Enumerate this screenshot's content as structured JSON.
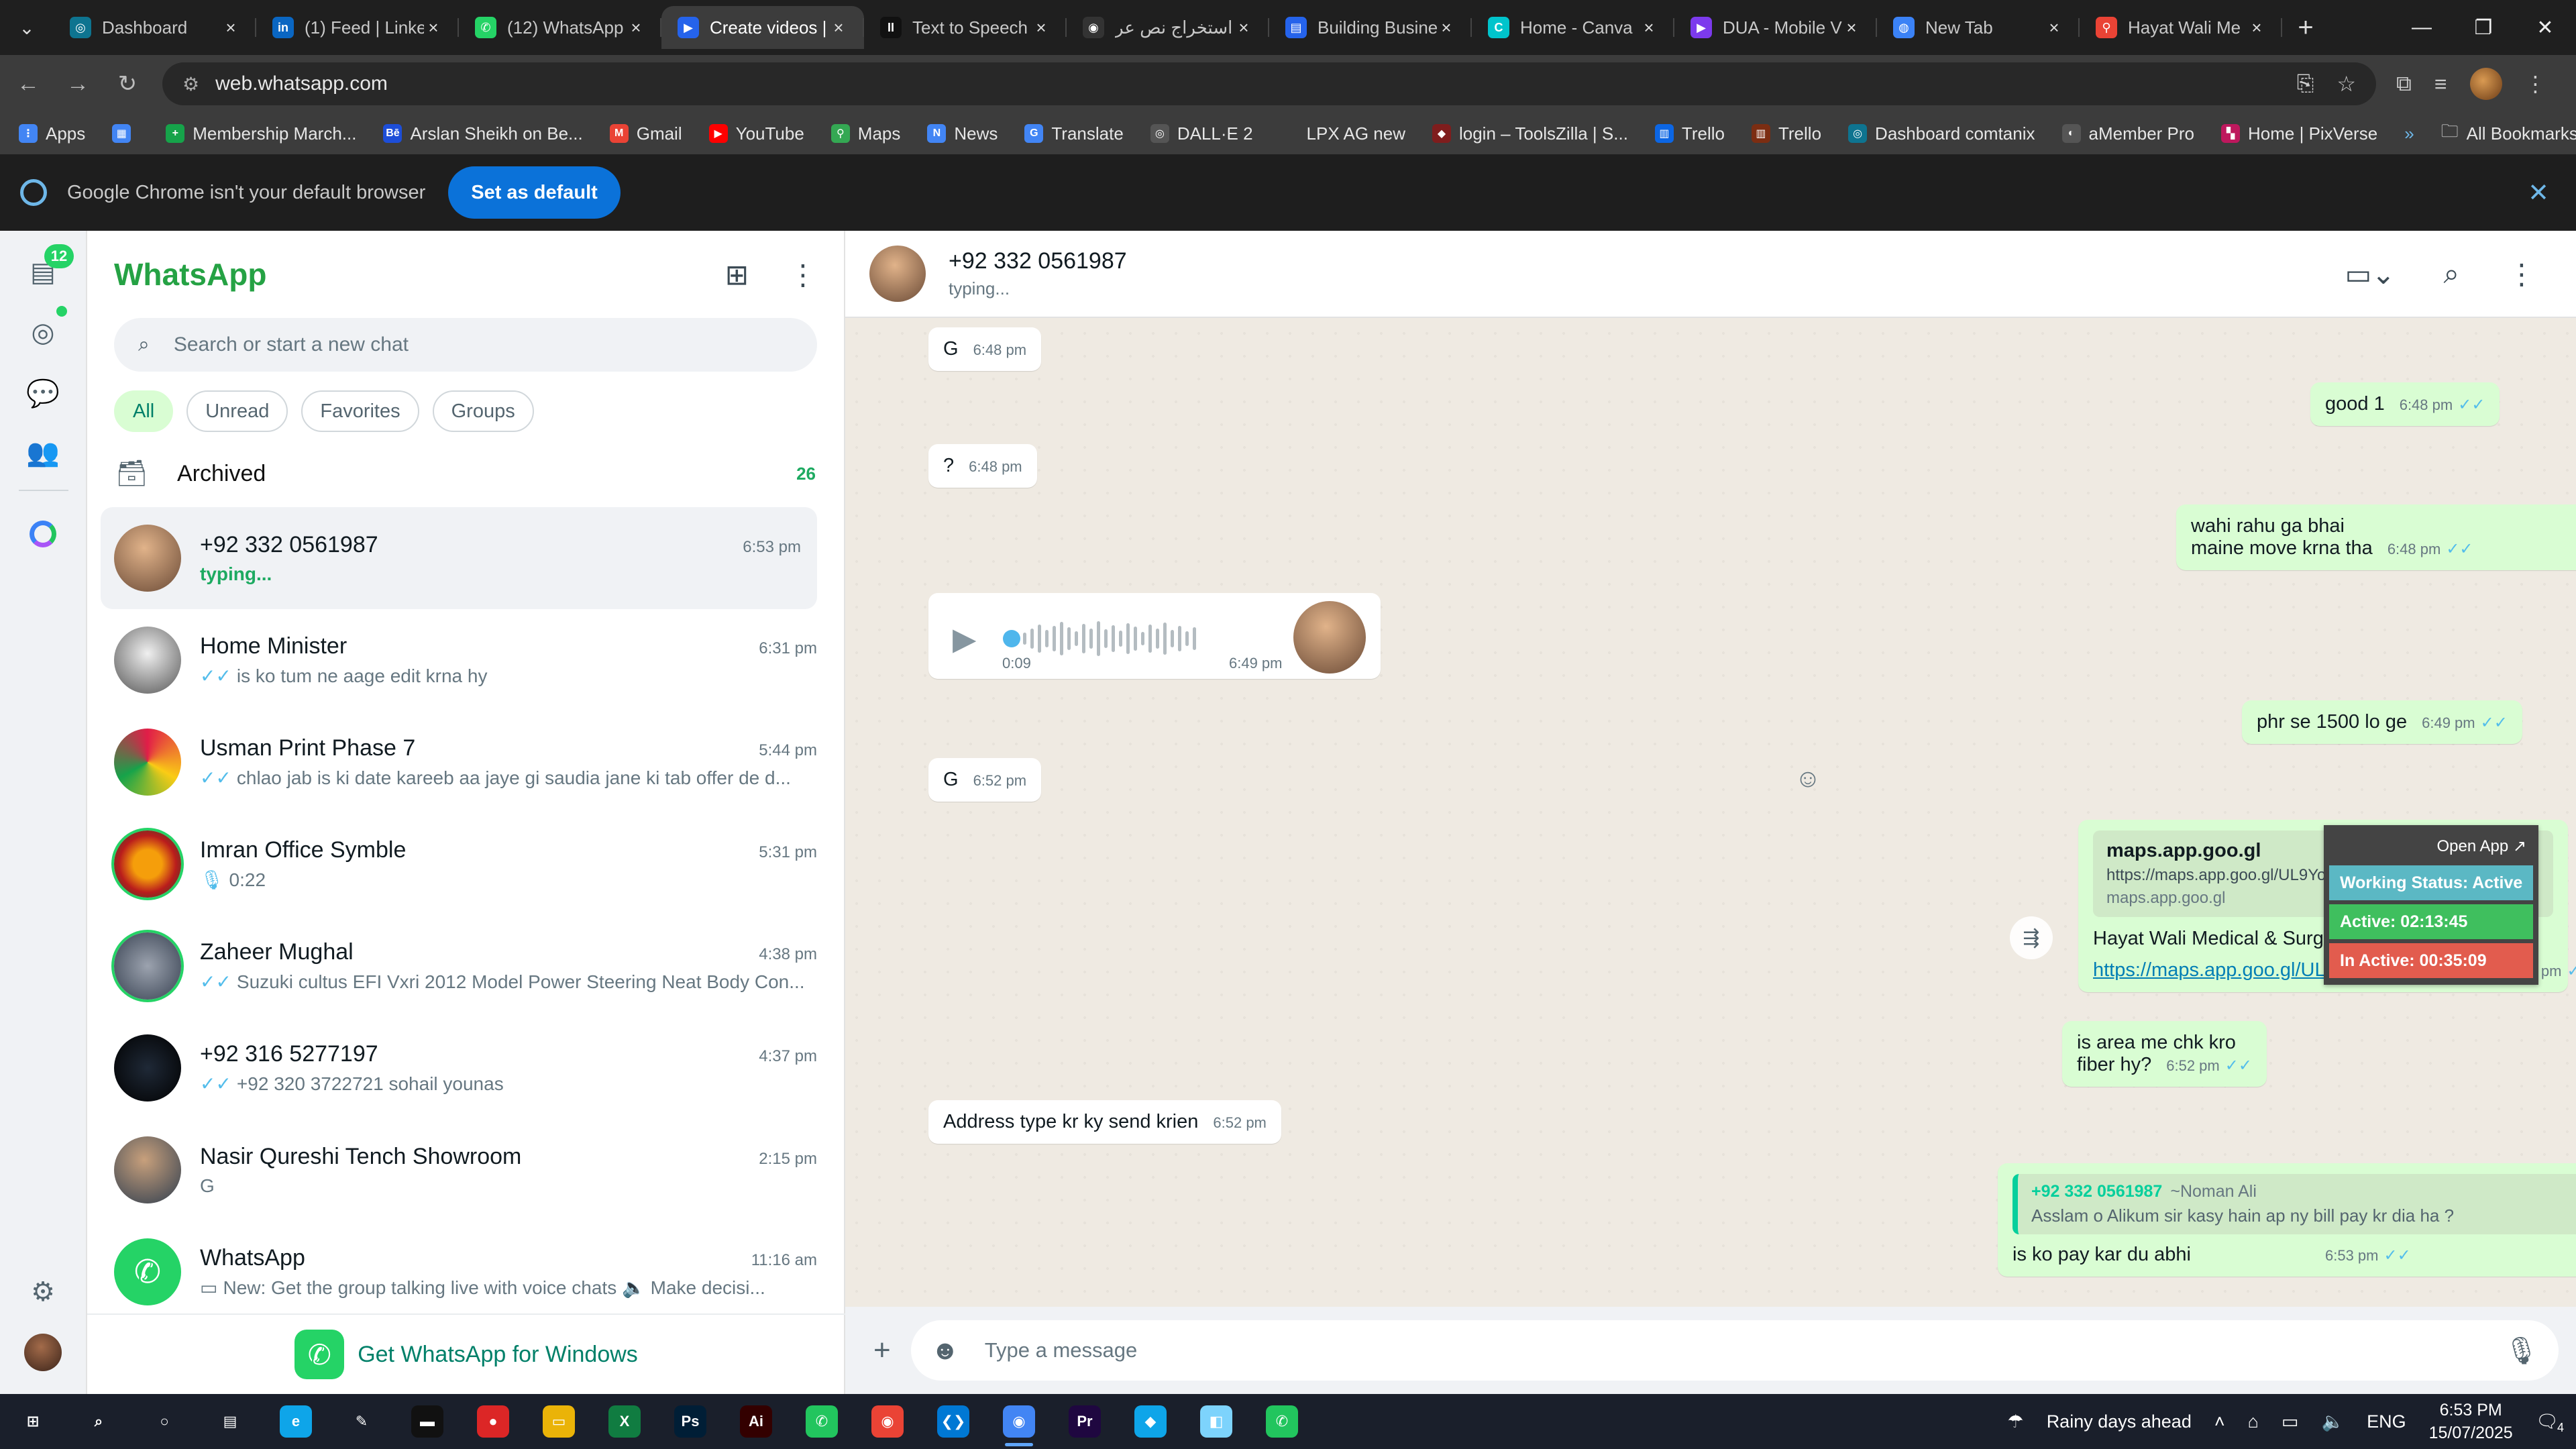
{
  "browser": {
    "tabs": [
      {
        "title": "Dashboard",
        "color": "#0e7490",
        "glyph": "◎"
      },
      {
        "title": "(1) Feed | Linke",
        "color": "#0a66c2",
        "glyph": "in"
      },
      {
        "title": "(12) WhatsApp",
        "color": "#25d366",
        "glyph": "✆"
      },
      {
        "title": "Create videos |",
        "color": "#2563eb",
        "glyph": "▶",
        "active": true
      },
      {
        "title": "Text to Speech",
        "color": "#111111",
        "glyph": "II"
      },
      {
        "title": "استخراج نص عر",
        "color": "#333333",
        "glyph": "◉"
      },
      {
        "title": "Building Busine",
        "color": "#2563eb",
        "glyph": "▤"
      },
      {
        "title": "Home - Canva",
        "color": "#00c4cc",
        "glyph": "C"
      },
      {
        "title": "DUA - Mobile V",
        "color": "#7c3aed",
        "glyph": "▶"
      },
      {
        "title": "New Tab",
        "color": "#3b82f6",
        "glyph": "◍"
      },
      {
        "title": "Hayat Wali Me",
        "color": "#ea4335",
        "glyph": "⚲"
      }
    ],
    "new_tab": "+",
    "url": "web.whatsapp.com",
    "bookmarks": [
      {
        "label": "Apps",
        "color": "#4285f4",
        "glyph": "⋮"
      },
      {
        "label": "",
        "color": "#4285f4",
        "glyph": "▦"
      },
      {
        "label": "Membership March...",
        "color": "#16a34a",
        "glyph": "+"
      },
      {
        "label": "Arslan Sheikh on Be...",
        "color": "#1d4ed8",
        "glyph": "Bē"
      },
      {
        "label": "Gmail",
        "color": "#ea4335",
        "glyph": "M"
      },
      {
        "label": "YouTube",
        "color": "#ff0000",
        "glyph": "▶"
      },
      {
        "label": "Maps",
        "color": "#34a853",
        "glyph": "⚲"
      },
      {
        "label": "News",
        "color": "#4285f4",
        "glyph": "N"
      },
      {
        "label": "Translate",
        "color": "#4285f4",
        "glyph": "G"
      },
      {
        "label": "DALL·E 2",
        "color": "#555555",
        "glyph": "◎"
      },
      {
        "label": "LPX AG new",
        "color": "#3c3c3c",
        "glyph": ""
      },
      {
        "label": "login – ToolsZilla | S...",
        "color": "#7f1d1d",
        "glyph": "◆"
      },
      {
        "label": "Trello",
        "color": "#0c66e4",
        "glyph": "▥"
      },
      {
        "label": "Trello",
        "color": "#7c2d12",
        "glyph": "▥"
      },
      {
        "label": "Dashboard comtanix",
        "color": "#0e7490",
        "glyph": "◎"
      },
      {
        "label": "aMember Pro",
        "color": "#555555",
        "glyph": "◐"
      },
      {
        "label": "Home | PixVerse",
        "color": "#be185d",
        "glyph": "▚"
      }
    ],
    "all_bookmarks": "All Bookmarks",
    "infobar_text": "Google Chrome isn't your default browser",
    "set_default": "Set as default"
  },
  "rail": {
    "unread_badge": "12"
  },
  "sidebar": {
    "title": "WhatsApp",
    "search_placeholder": "Search or start a new chat",
    "filters": [
      "All",
      "Unread",
      "Favorites",
      "Groups"
    ],
    "archived_label": "Archived",
    "archived_count": "26",
    "chats": [
      {
        "name": "+92 332 0561987",
        "time": "6:53 pm",
        "preview": "typing...",
        "typing": true,
        "ticks": false,
        "av": "radial-gradient(circle at 45% 35%, #e1b38a, #6a4a36)"
      },
      {
        "name": "Home Minister",
        "time": "6:31 pm",
        "preview": "is ko tum ne aage edit krna hy",
        "ticks": true,
        "av": "radial-gradient(circle at 50% 40%, #f0f0f0, #555)"
      },
      {
        "name": "Usman Print Phase 7",
        "time": "5:44 pm",
        "preview": "chlao jab is ki date kareeb aa jaye gi  saudia jane ki tab offer de d...",
        "ticks": true,
        "av": "conic-gradient(#e11d48, #facc15, #16a34a, #e11d48)"
      },
      {
        "name": "Imran Office Symble",
        "time": "5:31 pm",
        "preview": "0:22",
        "ticks": false,
        "mic": true,
        "av": "radial-gradient(circle, #f59e0b 30%, #b91c1c 60%, #14532d)"
      },
      {
        "name": "Zaheer Mughal",
        "time": "4:38 pm",
        "preview": "Suzuki cultus EFI Vxri 2012 Model Power Steering Neat Body Con...",
        "ticks": true,
        "av": "radial-gradient(circle, #9ca3af, #374151)"
      },
      {
        "name": "+92 316 5277197",
        "time": "4:37 pm",
        "preview": "+92 320 3722721  sohail younas",
        "ticks": true,
        "av": "radial-gradient(circle, #1f2937, #000)"
      },
      {
        "name": "Nasir Qureshi Tench Showroom",
        "time": "2:15 pm",
        "preview": "G",
        "ticks": false,
        "av": "radial-gradient(circle at 45% 35%, #c8a07c, #2f3e4f)"
      },
      {
        "name": "WhatsApp",
        "time": "11:16 am",
        "preview": "New: Get the group talking live with voice chats 🔈 Make decisi...",
        "ticks": false,
        "video": true,
        "av": "radial-gradient(circle, #25d366, #25d366)"
      }
    ],
    "get_windows": "Get WhatsApp for Windows"
  },
  "conversation": {
    "contact": "+92 332 0561987",
    "status": "typing...",
    "messages": {
      "m1": {
        "text": "G",
        "time": "6:48 pm"
      },
      "m2": {
        "text": "good 1",
        "time": "6:48 pm"
      },
      "m3": {
        "text": "?",
        "time": "6:48 pm"
      },
      "m4": {
        "line1": "wahi rahu ga bhai",
        "line2": "maine move krna tha",
        "time": "6:48 pm"
      },
      "voice": {
        "duration": "0:09",
        "time": "6:49 pm"
      },
      "m5": {
        "text": "phr se 1500 lo ge",
        "time": "6:49 pm"
      },
      "m6": {
        "text": "G",
        "time": "6:52 pm"
      },
      "link": {
        "preview_title": "maps.app.goo.gl",
        "preview_desc": "https://maps.app.goo.gl/UL9YoezztD1TCh3RA",
        "preview_site": "maps.app.goo.gl",
        "text": "Hayat Wali Medical & Surgical Complex",
        "url": "https://maps.app.goo.gl/UL9YoezztD1TCh3RA",
        "time": "6:52 pm"
      },
      "m7": {
        "line1": "is area me chk kro",
        "line2": "fiber hy?",
        "time": "6:52 pm"
      },
      "m8": {
        "text": "Address type kr ky send krien",
        "time": "6:52 pm"
      },
      "reply": {
        "quote_name": "+92 332 0561987",
        "quote_alias": "~Noman Ali",
        "quote_text": "Asslam o Alikum sir kasy hain ap ny bill pay kr dia ha ?",
        "text": "is ko pay kar du abhi",
        "time": "6:53 pm"
      }
    },
    "composer_placeholder": "Type a message"
  },
  "widget": {
    "open_app": "Open App ↗",
    "status": "Working Status: Active",
    "active": "Active: 02:13:45",
    "inactive": "In Active: 00:35:09",
    "colors": {
      "status": "#5bb8c4",
      "active": "#3fbf5e",
      "inactive": "#e25c4e"
    }
  },
  "taskbar": {
    "weather": "Rainy days ahead",
    "lang": "ENG",
    "time": "6:53 PM",
    "date": "15/07/2025",
    "notifications": "4",
    "apps": [
      {
        "glyph": "⊞",
        "color": "transparent"
      },
      {
        "glyph": "⌕",
        "color": "transparent"
      },
      {
        "glyph": "○",
        "color": "transparent"
      },
      {
        "glyph": "▤",
        "color": "transparent"
      },
      {
        "glyph": "e",
        "color": "#0ea5e9"
      },
      {
        "glyph": "✎",
        "color": "transparent"
      },
      {
        "glyph": "▬",
        "color": "#111111"
      },
      {
        "glyph": "●",
        "color": "#dc2626"
      },
      {
        "glyph": "▭",
        "color": "#eab308"
      },
      {
        "glyph": "X",
        "color": "#107c41"
      },
      {
        "glyph": "Ps",
        "color": "#001e36"
      },
      {
        "glyph": "Ai",
        "color": "#330000"
      },
      {
        "glyph": "✆",
        "color": "#22c55e"
      },
      {
        "glyph": "◉",
        "color": "#ea4335"
      },
      {
        "glyph": "❮❯",
        "color": "#0078d4"
      },
      {
        "glyph": "◉",
        "color": "#4285f4",
        "active": true
      },
      {
        "glyph": "Pr",
        "color": "#1f0740"
      },
      {
        "glyph": "◆",
        "color": "#0ea5e9"
      },
      {
        "glyph": "◧",
        "color": "#7dd3fc"
      },
      {
        "glyph": "✆",
        "color": "#22c55e"
      }
    ]
  }
}
